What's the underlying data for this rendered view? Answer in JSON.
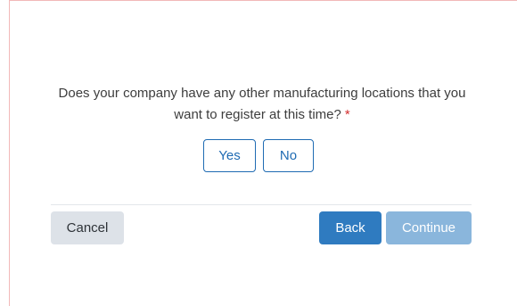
{
  "question": {
    "text": "Does your company have any other manufacturing locations that you want to register at this time?",
    "required_marker": "*"
  },
  "choices": {
    "yes_label": "Yes",
    "no_label": "No"
  },
  "actions": {
    "cancel_label": "Cancel",
    "back_label": "Back",
    "continue_label": "Continue"
  },
  "colors": {
    "primary": "#2f7bc0",
    "primary_disabled": "#8ab6dc",
    "secondary": "#dde2e8",
    "required": "#d32f2f",
    "outline": "#1f6bb3"
  }
}
